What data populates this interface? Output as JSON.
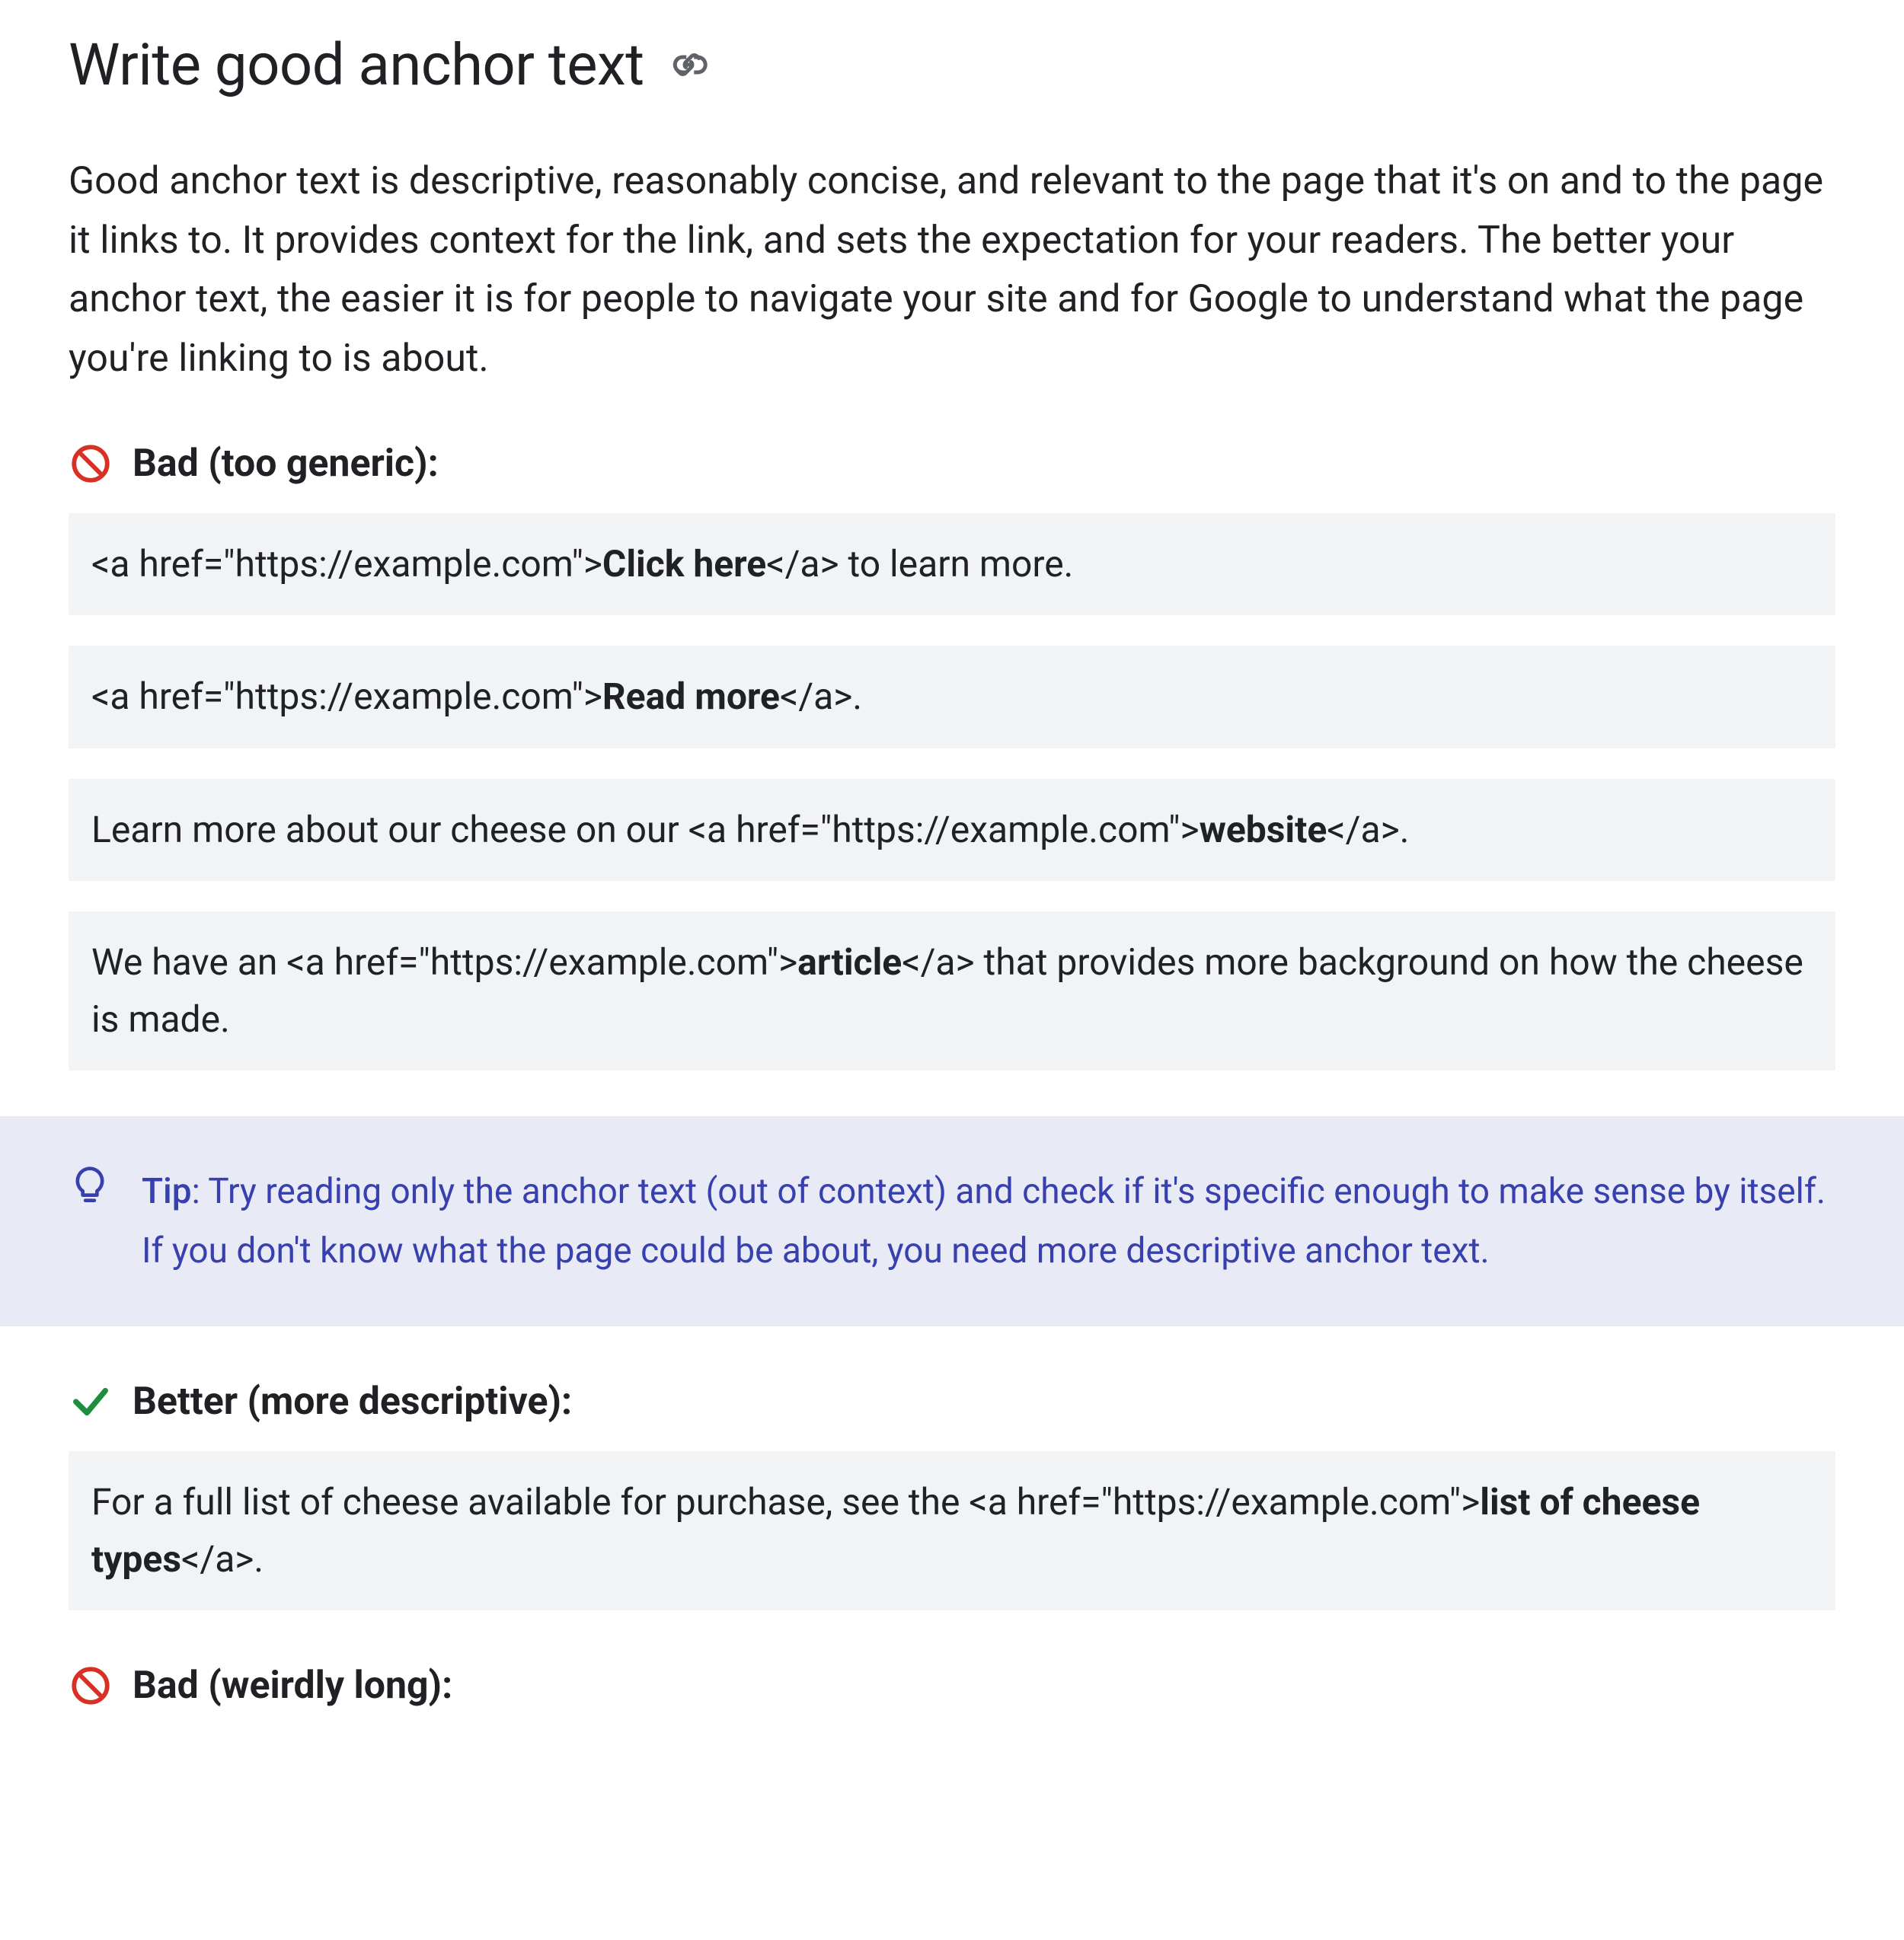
{
  "heading": "Write good anchor text",
  "intro": "Good anchor text is descriptive, reasonably concise, and relevant to the page that it's on and to the page it links to. It provides context for the link, and sets the expectation for your readers. The better your anchor text, the easier it is for people to navigate your site and for Google to understand what the page you're linking to is about.",
  "labels": {
    "bad_generic": "Bad (too generic):",
    "better": "Better (more descriptive):",
    "bad_long": "Bad (weirdly long):"
  },
  "examples": {
    "bad": [
      {
        "pre": "<a href=\"https://example.com\">",
        "bold": "Click here",
        "post": "</a> to learn more."
      },
      {
        "pre": "<a href=\"https://example.com\">",
        "bold": "Read more",
        "post": "</a>."
      },
      {
        "pre": "Learn more about our cheese on our <a href=\"https://example.com\">",
        "bold": "website",
        "post": "</a>."
      },
      {
        "pre": "We have an <a href=\"https://example.com\">",
        "bold": "article",
        "post": "</a> that provides more background on how the cheese is made."
      }
    ],
    "good": [
      {
        "pre": "For a full list of cheese available for purchase, see the <a href=\"https://example.com\">",
        "bold": "list of cheese types",
        "post": "</a>."
      }
    ]
  },
  "tip": {
    "label": "Tip",
    "body": ": Try reading only the anchor text (out of context) and check if it's specific enough to make sense by itself. If you don't know what the page could be about, you need more descriptive anchor text."
  }
}
